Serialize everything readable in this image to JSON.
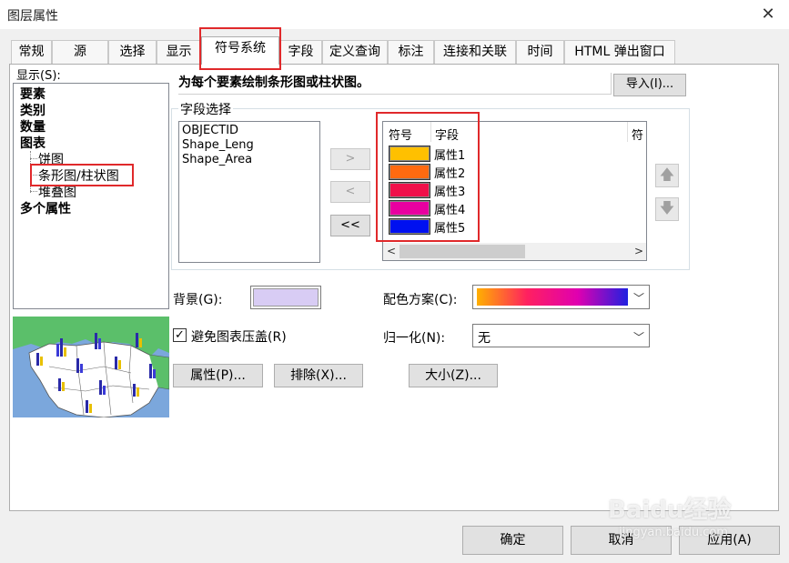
{
  "window": {
    "title": "图层属性"
  },
  "tabs": [
    "常规",
    "源",
    "选择",
    "显示",
    "符号系统",
    "字段",
    "定义查询",
    "标注",
    "连接和关联",
    "时间",
    "HTML 弹出窗口"
  ],
  "show": {
    "label": "显示(S):",
    "items": [
      "要素",
      "类别",
      "数量",
      "图表",
      "饼图",
      "条形图/柱状图",
      "堆叠图",
      "多个属性"
    ]
  },
  "description": "为每个要素绘制条形图或柱状图。",
  "import_button": "导入(I)...",
  "field_selection": {
    "label": "字段选择",
    "available_fields": [
      "OBJECTID",
      "Shape_Leng",
      "Shape_Area"
    ],
    "move_buttons": {
      "add": ">",
      "remove": "<",
      "remove_all": "<<"
    },
    "columns": {
      "symbol": "符号",
      "field": "字段",
      "extra": "符"
    },
    "selected": [
      {
        "field": "属性1",
        "color": "#FFC000"
      },
      {
        "field": "属性2",
        "color": "#FF6A10"
      },
      {
        "field": "属性3",
        "color": "#F0104A"
      },
      {
        "field": "属性4",
        "color": "#E800A0"
      },
      {
        "field": "属性5",
        "color": "#0010F0"
      }
    ]
  },
  "background": {
    "label": "背景(G):",
    "color": "#D8CCF4"
  },
  "color_scheme": {
    "label": "配色方案(C):",
    "stops": [
      "#FFB000",
      "#FF2060",
      "#E000B0",
      "#2020E0"
    ]
  },
  "avoid_overlap": {
    "label": "避免图表压盖(R)",
    "checked": true
  },
  "normalization": {
    "label": "归一化(N):",
    "value": "无"
  },
  "buttons": {
    "properties": "属性(P)...",
    "exclusion": "排除(X)...",
    "size": "大小(Z)..."
  },
  "footer": {
    "ok": "确定",
    "cancel": "取消",
    "apply": "应用(A)"
  },
  "watermark": {
    "text": "Baidu经验",
    "url": "jingyan.baidu.com"
  }
}
